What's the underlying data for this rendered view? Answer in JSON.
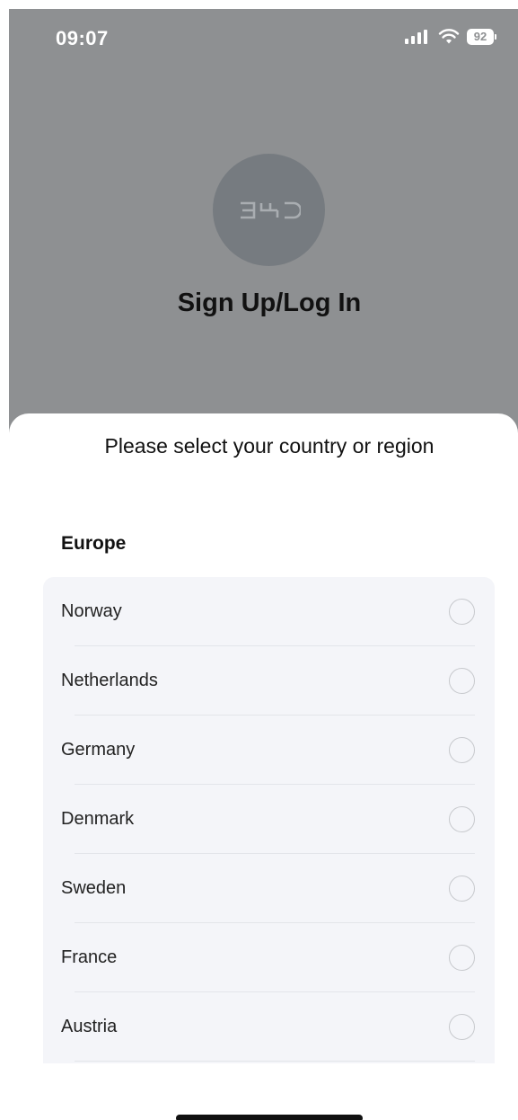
{
  "status_bar": {
    "time": "09:07",
    "battery": "92",
    "signal_icon": "cellular-signal-icon",
    "wifi_icon": "wifi-icon"
  },
  "header": {
    "logo_text": "BYD",
    "title": "Sign Up/Log In"
  },
  "sheet": {
    "title": "Please select your country or region",
    "region": "Europe",
    "countries": [
      {
        "label": "Norway",
        "selected": false
      },
      {
        "label": "Netherlands",
        "selected": false
      },
      {
        "label": "Germany",
        "selected": false
      },
      {
        "label": "Denmark",
        "selected": false
      },
      {
        "label": "Sweden",
        "selected": false
      },
      {
        "label": "France",
        "selected": false
      },
      {
        "label": "Austria",
        "selected": false
      }
    ]
  },
  "colors": {
    "backdrop": "#8e9092",
    "sheet_bg": "#ffffff",
    "list_bg": "#f4f5f9",
    "radio_border": "#c7c9cd"
  }
}
